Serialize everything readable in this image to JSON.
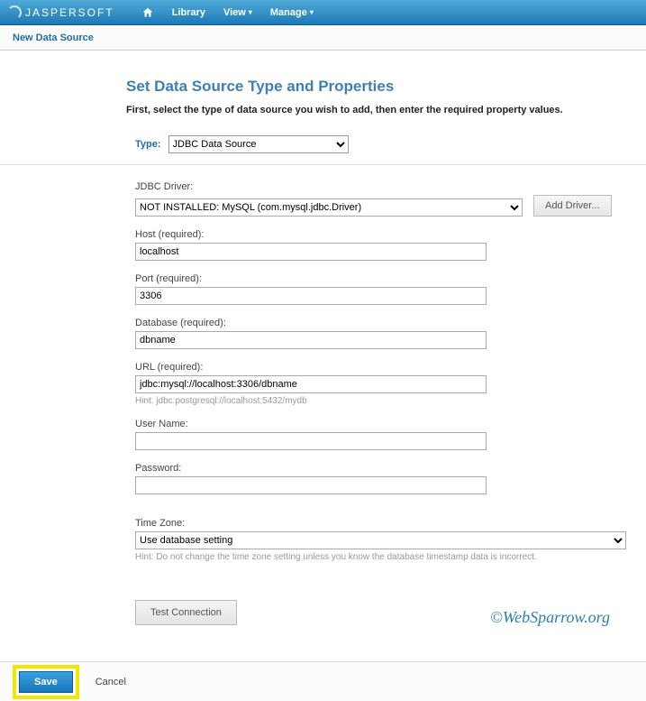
{
  "brand": "JASPERSOFT",
  "nav": {
    "library": "Library",
    "view": "View",
    "manage": "Manage"
  },
  "subheader": "New Data Source",
  "page": {
    "title": "Set Data Source Type and Properties",
    "desc": "First, select the type of data source you wish to add, then enter the required property values."
  },
  "type": {
    "label": "Type:",
    "value": "JDBC Data Source"
  },
  "fields": {
    "driver": {
      "label": "JDBC Driver:",
      "value": "NOT INSTALLED: MySQL (com.mysql.jdbc.Driver)",
      "add_btn": "Add Driver..."
    },
    "host": {
      "label": "Host (required):",
      "value": "localhost"
    },
    "port": {
      "label": "Port (required):",
      "value": "3306"
    },
    "database": {
      "label": "Database (required):",
      "value": "dbname"
    },
    "url": {
      "label": "URL (required):",
      "value": "jdbc:mysql://localhost:3306/dbname",
      "hint": "Hint: jdbc:postgresql://localhost:5432/mydb"
    },
    "user": {
      "label": "User Name:",
      "value": ""
    },
    "password": {
      "label": "Password:",
      "value": ""
    },
    "tz": {
      "label": "Time Zone:",
      "value": "Use database setting",
      "hint": "Hint: Do not change the time zone setting unless you know the database timestamp data is incorrect."
    }
  },
  "buttons": {
    "test": "Test Connection",
    "save": "Save",
    "cancel": "Cancel"
  },
  "watermark": "©WebSparrow.org"
}
